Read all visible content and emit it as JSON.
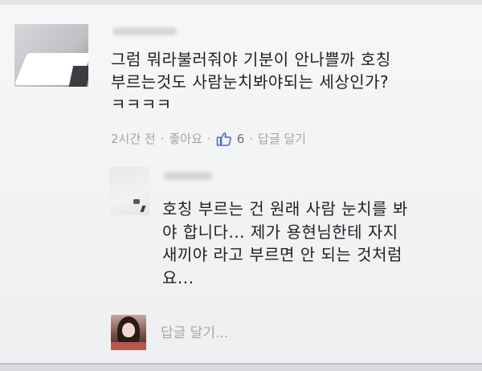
{
  "comment": {
    "lines": [
      "그럼 뭐라불러줘야 기분이 안나쁠까 호칭",
      "부르는것도 사람눈치봐야되는 세상인가?",
      "ㅋㅋㅋㅋ"
    ],
    "actions": {
      "time": "2시간 전",
      "like_label": "좋아요",
      "like_count": "6",
      "reply_label": "답글 달기",
      "separator": "·"
    }
  },
  "reply": {
    "lines": [
      "호칭 부르는 건 원래 사람 눈치를 봐",
      "야 합니다... 제가 용현님한테 자지",
      "새끼야 라고 부르면 안 되는 것처럼",
      "요..."
    ]
  },
  "composer": {
    "placeholder": "답글 달기..."
  },
  "icons": {
    "like": "thumbs-up-icon"
  },
  "colors": {
    "like_blue": "#4a6fbd",
    "meta_gray": "#a1a4a9"
  }
}
